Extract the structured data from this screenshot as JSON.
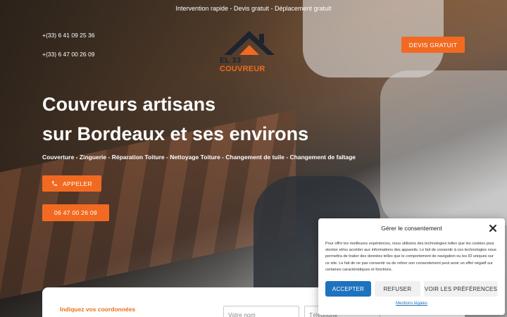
{
  "topbar": {
    "tagline": "Intervention rapide - Devis gratuit - Déplacement gratuit"
  },
  "contact": {
    "phone_1": "+(33) 6 41 09 25 36",
    "phone_2": "+(33) 6 47 00 26 09"
  },
  "logo": {
    "text_dark": "EL 33",
    "text_accent": "COUVREUR"
  },
  "header": {
    "devis_button": "DEVIS GRATUIT"
  },
  "hero": {
    "title_line1": "Couvreurs artisans",
    "title_line2": "sur Bordeaux et ses environs",
    "subtitle": "Couverture - Zinguerie - Réparation Toiture - Nettoyage Toiture - Changement de tuile - Changement de faîtage",
    "call_button": "APPELER",
    "number_button": "06 47 00 26 09"
  },
  "form": {
    "heading": "Indiquez vos coordonnées",
    "name_placeholder": "Votre nom",
    "phone_placeholder": "Téléphone"
  },
  "consent": {
    "title": "Gérer le consentement",
    "body": "Pour offrir les meilleures expériences, nous utilisons des technologies telles que les cookies pour stocker et/ou accéder aux informations des appareils. Le fait de consentir à ces technologies nous permettra de traiter des données telles que le comportement de navigation ou les ID uniques sur ce site. Le fait de ne pas consentir ou de retirer son consentement peut avoir un effet négatif sur certaines caractéristiques et fonctions.",
    "accept": "ACCEPTER",
    "refuse": "REFUSER",
    "preferences": "VOIR LES PRÉFÉRENCES",
    "legal_link": "Mentions légales"
  },
  "colors": {
    "accent": "#f26a21",
    "consent_primary": "#1e73be",
    "logo_dark": "#1c2430"
  },
  "icons": {
    "call": "phone-icon",
    "close": "close-icon"
  }
}
